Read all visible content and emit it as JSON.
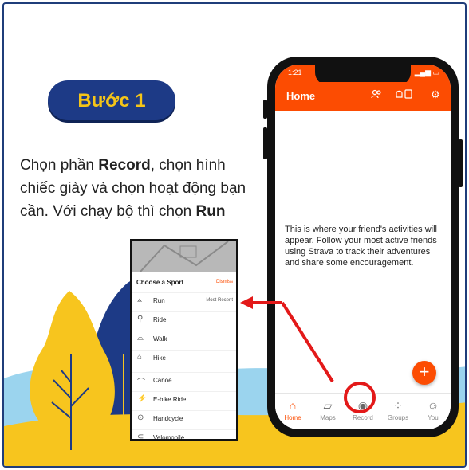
{
  "badge": {
    "label": "Bước 1"
  },
  "instruction": {
    "part1": "Chọn phần ",
    "bold1": "Record",
    "part2": ", chọn hình chiếc giày và chọn hoạt động bạn cần. Với chạy bộ thì chọn ",
    "bold2": "Run"
  },
  "phone": {
    "status_time": "1:21",
    "app_title": "Home",
    "header_icons": [
      "people-icon",
      "notification-icon",
      "settings-icon"
    ],
    "feed_message": "This is where your friend's activities will appear. Follow your most active friends using Strava to track their adventures and share some encouragement.",
    "fab_label": "+",
    "tabs": [
      {
        "label": "Home",
        "icon": "home-icon",
        "active": true
      },
      {
        "label": "Maps",
        "icon": "map-icon",
        "active": false
      },
      {
        "label": "Record",
        "icon": "record-icon",
        "active": false
      },
      {
        "label": "Groups",
        "icon": "groups-icon",
        "active": false
      },
      {
        "label": "You",
        "icon": "profile-icon",
        "active": false
      }
    ]
  },
  "sport_chooser": {
    "title": "Choose a Sport",
    "dismiss": "Dismiss",
    "sports": [
      {
        "label": "Run",
        "icon": "shoe-icon",
        "badge": "Most Recent"
      },
      {
        "label": "Ride",
        "icon": "bike-icon",
        "badge": ""
      },
      {
        "label": "Walk",
        "icon": "walk-icon",
        "badge": ""
      },
      {
        "label": "Hike",
        "icon": "hike-icon",
        "badge": ""
      },
      {
        "label": "Canoe",
        "icon": "canoe-icon",
        "badge": ""
      },
      {
        "label": "E-bike Ride",
        "icon": "ebike-icon",
        "badge": ""
      },
      {
        "label": "Handcycle",
        "icon": "handcycle-icon",
        "badge": ""
      },
      {
        "label": "Velomobile",
        "icon": "velomobile-icon",
        "badge": ""
      }
    ]
  },
  "colors": {
    "brand": "#fc4c02",
    "badge_bg": "#1d3a86",
    "badge_text": "#f5c518",
    "highlight": "#e31919",
    "sky_blue": "#9bd4ee",
    "hill_navy": "#1d3a86",
    "ground_yellow": "#f7c51e"
  }
}
